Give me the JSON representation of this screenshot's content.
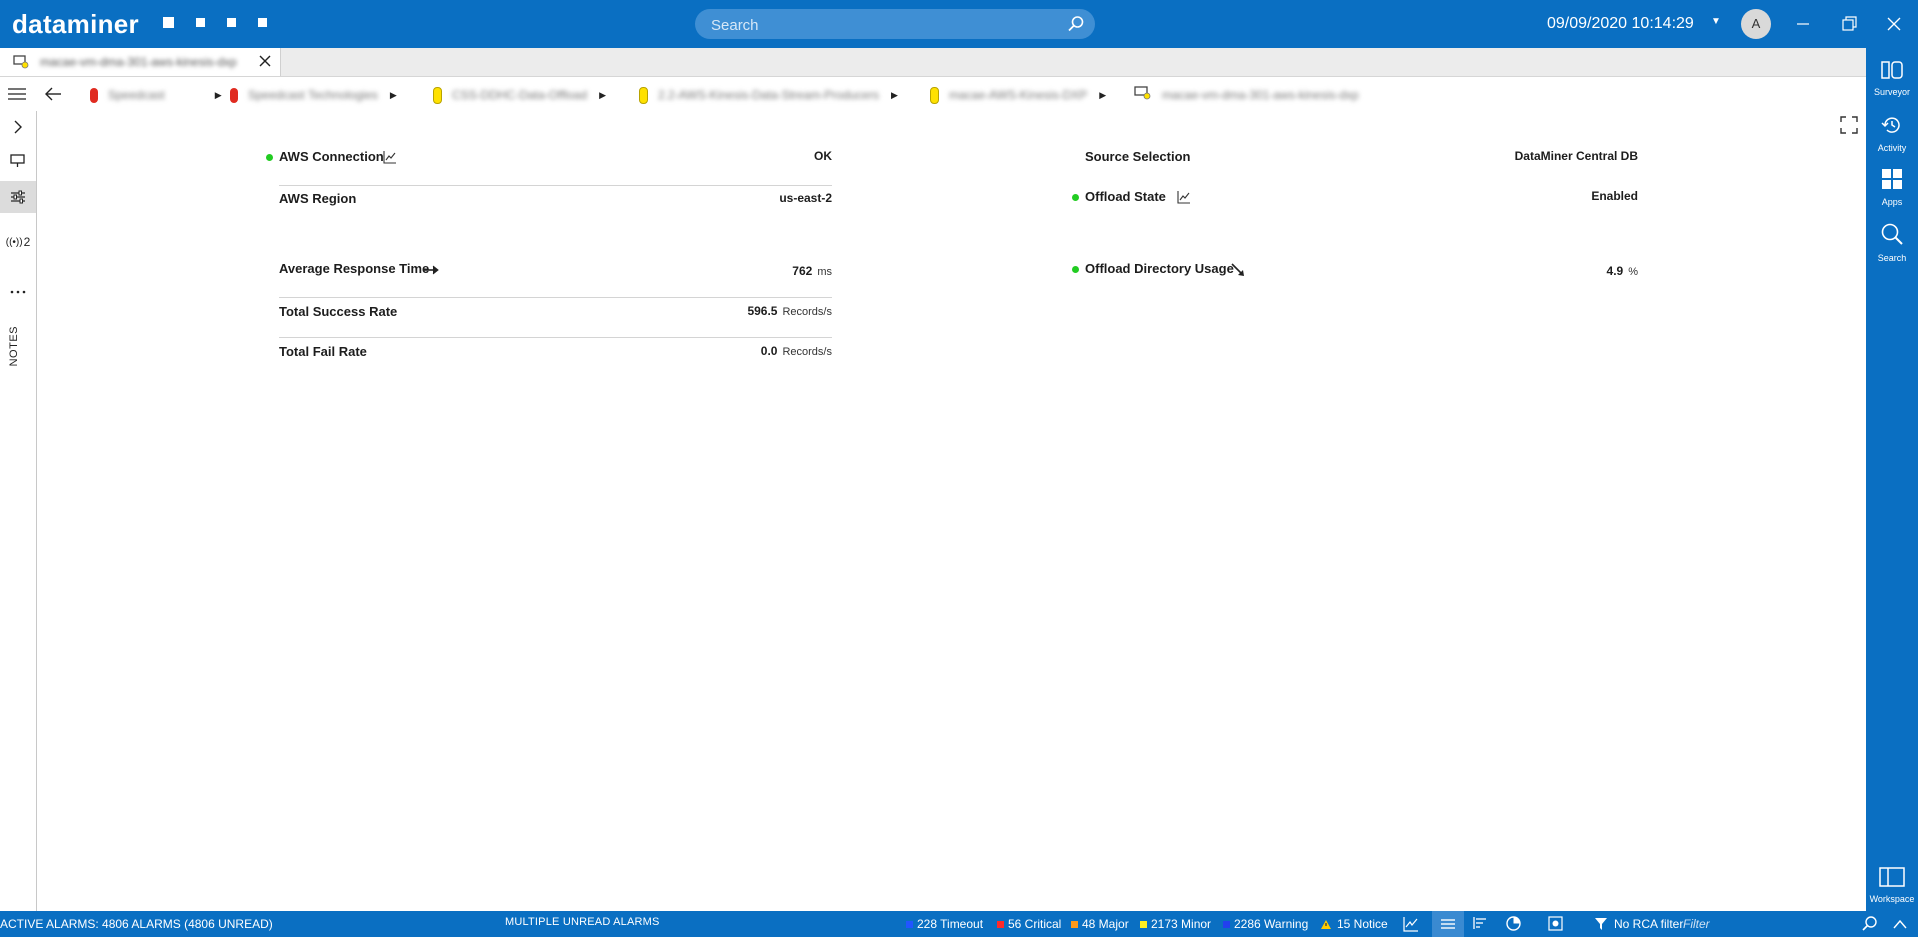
{
  "app": {
    "logo": "dataminer",
    "datetime": "09/09/2020 10:14:29",
    "user_initial": "A"
  },
  "search": {
    "placeholder": "Search"
  },
  "tab": {
    "title": "macae-vm-dma-301-aws-kinesis-dxp"
  },
  "breadcrumb": [
    {
      "label": "Speedcast",
      "icon": "red-alarm-pill"
    },
    {
      "label": "Speedcast Technologies",
      "icon": "red-alarm-pill"
    },
    {
      "label": "CSS-DDHC-Data-Offload",
      "icon": "yellow-alarm-pill"
    },
    {
      "label": "2.2-AWS-Kinesis-Data-Stream-Producers",
      "icon": "yellow-alarm-pill"
    },
    {
      "label": "macae-AWS-Kinesis-DXP",
      "icon": "yellow-alarm-pill"
    },
    {
      "label": "macae-vm-dma-301-aws-kinesis-dxp",
      "icon": "element-icon"
    }
  ],
  "left_rail": {
    "alarm_count": "2",
    "notes_label": "NOTES"
  },
  "right_rail": {
    "surveyor": "Surveyor",
    "activity": "Activity",
    "apps": "Apps",
    "search": "Search",
    "workspace": "Workspace"
  },
  "params": {
    "aws_connection": {
      "name": "AWS Connection",
      "value": "OK"
    },
    "aws_region": {
      "name": "AWS Region",
      "value": "us-east-2"
    },
    "avg_response": {
      "name": "Average Response Time",
      "value": "762",
      "unit": "ms"
    },
    "success_rate": {
      "name": "Total Success Rate",
      "value": "596.5",
      "unit": "Records/s"
    },
    "fail_rate": {
      "name": "Total Fail Rate",
      "value": "0.0",
      "unit": "Records/s"
    },
    "source_selection": {
      "name": "Source Selection",
      "value": "DataMiner Central DB"
    },
    "offload_state": {
      "name": "Offload State",
      "value": "Enabled"
    },
    "offload_dir": {
      "name": "Offload Directory Usage",
      "value": "4.9",
      "unit": "%"
    }
  },
  "status_bar": {
    "active_alarms": "ACTIVE ALARMS: 4806 ALARMS (4806 UNREAD)",
    "unread_label": "MULTIPLE UNREAD ALARMS",
    "timeout": "228 Timeout",
    "critical": "56 Critical",
    "major": "48 Major",
    "minor": "2173 Minor",
    "warning": "2286 Warning",
    "notice": "15 Notice",
    "rca": "No RCA filter",
    "filter_placeholder": "Filter"
  },
  "colors": {
    "brand_blue": "#0a6fc2",
    "ok_green": "#22cc22",
    "timeout": "#2255ff",
    "critical": "#ff2a2a",
    "major": "#ff9a1a",
    "minor": "#ffee22",
    "warning": "#2240ee",
    "notice": "#ffcc00"
  }
}
